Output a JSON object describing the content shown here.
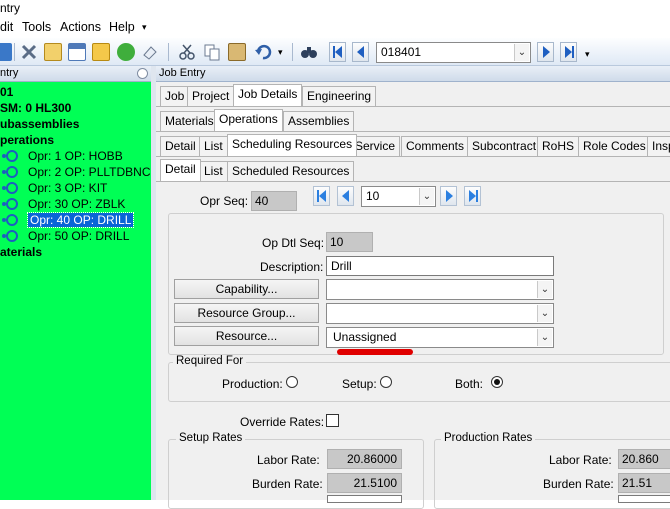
{
  "window": {
    "title": "ntry"
  },
  "menu": {
    "edit": "dit",
    "tools": "Tools",
    "actions": "Actions",
    "help": "Help"
  },
  "toolbar": {
    "record_value": "018401",
    "overflow_glyph": "▾"
  },
  "tree_panel": {
    "header": "ntry",
    "items": [
      {
        "text": "01",
        "bold": true
      },
      {
        "text": "SM: 0 HL300",
        "bold": true
      },
      {
        "text": "ubassemblies",
        "bold": true
      },
      {
        "text": "perations",
        "bold": true
      },
      {
        "text": "Opr: 1 OP: HOBB",
        "bold": false
      },
      {
        "text": "Opr: 2 OP: PLLTDBNC",
        "bold": false
      },
      {
        "text": "Opr: 3 OP: KIT",
        "bold": false
      },
      {
        "text": "Opr: 30 OP: ZBLK",
        "bold": false
      },
      {
        "text": "Opr: 40 OP: DRILL",
        "bold": false,
        "selected": true
      },
      {
        "text": "Opr: 50 OP: DRILL",
        "bold": false
      },
      {
        "text": "aterials",
        "bold": true
      }
    ]
  },
  "job_entry": {
    "header": "Job Entry",
    "tabs_level1": [
      "Job",
      "Project",
      "Job Details",
      "Engineering"
    ],
    "tabs_level2": [
      "Materials",
      "Operations",
      "Assemblies"
    ],
    "tabs_level3": [
      "Detail",
      "List",
      "Scheduling Resources",
      "Service",
      "Comments",
      "Subcontract",
      "RoHS",
      "Role Codes",
      "Insp"
    ],
    "tabs_level4": [
      "Detail",
      "List",
      "Scheduled Resources"
    ],
    "opr_seq_label": "Opr Seq:",
    "opr_seq_value": "40",
    "nav_value": "10",
    "op_dtl_seq_label": "Op Dtl Seq:",
    "op_dtl_seq_value": "10",
    "description_label": "Description:",
    "description_value": "Drill",
    "capability_button": "Capability...",
    "capability_value": "",
    "resource_group_button": "Resource Group...",
    "resource_group_value": "",
    "resource_button": "Resource...",
    "resource_value": "Unassigned",
    "required_for": {
      "title": "Required For",
      "production": "Production:",
      "setup": "Setup:",
      "both": "Both:",
      "selected": "Both"
    },
    "override_rates_label": "Override Rates:",
    "setup_rates": {
      "title": "Setup Rates",
      "labor_label": "Labor Rate:",
      "labor_value": "20.86000",
      "burden_label": "Burden Rate:",
      "burden_value": "21.5100"
    },
    "production_rates": {
      "title": "Production Rates",
      "labor_label": "Labor Rate:",
      "labor_value": "20.860",
      "burden_label": "Burden Rate:",
      "burden_value": "21.51"
    }
  },
  "colors": {
    "tree_background": "#00ff55",
    "selection": "#0a64d6",
    "annotation": "#e00000"
  }
}
